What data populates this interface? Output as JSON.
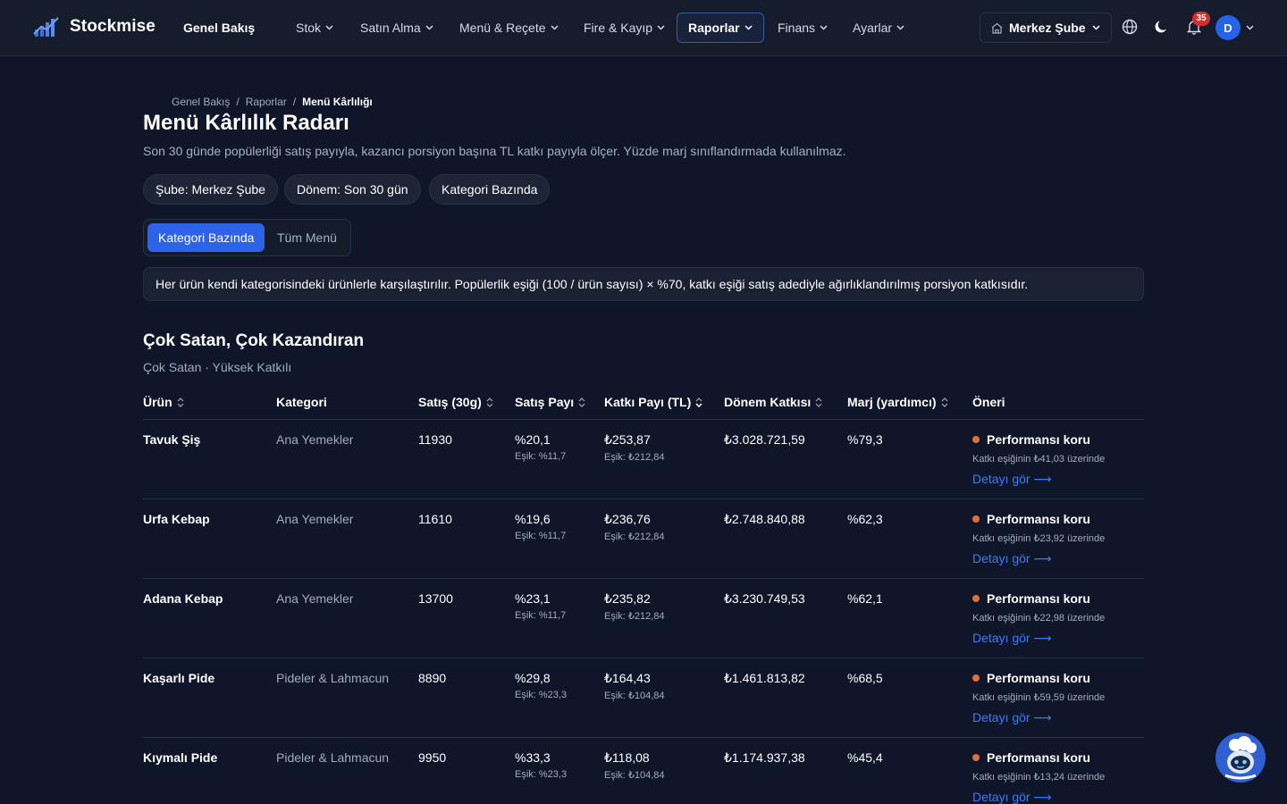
{
  "brand": {
    "name": "Stockmise"
  },
  "nav": {
    "items": [
      {
        "label": "Genel Bakış"
      },
      {
        "label": "Stok"
      },
      {
        "label": "Satın Alma"
      },
      {
        "label": "Menü & Reçete"
      },
      {
        "label": "Fire & Kayıp"
      },
      {
        "label": "Raporlar"
      },
      {
        "label": "Finans"
      },
      {
        "label": "Ayarlar"
      }
    ],
    "active": "Raporlar",
    "branch": "Merkez Şube",
    "notification_count": "35",
    "avatar_initial": "D"
  },
  "breadcrumb": {
    "home": "Genel Bakış",
    "section": "Raporlar",
    "current": "Menü Kârlılığı",
    "separator": "/"
  },
  "page": {
    "title": "Menü Kârlılık Radarı",
    "description": "Son 30 günde popülerliği satış payıyla, kazancı porsiyon başına TL katkı payıyla ölçer. Yüzde marj sınıflandırmada kullanılmaz."
  },
  "filters": {
    "branch": "Şube: Merkez Şube",
    "period": "Dönem: Son 30 gün",
    "mode": "Kategori Bazında"
  },
  "toggle": {
    "option_a": "Kategori Bazında",
    "option_b": "Tüm Menü",
    "selected": "Kategori Bazında"
  },
  "info": "Her ürün kendi kategorisindeki ürünlerle karşılaştırılır. Popülerlik eşiği (100 / ürün sayısı) × %70, katkı eşiği satış adediyle ağırlıklandırılmış porsiyon katkısıdır.",
  "section": {
    "title": "Çok Satan, Çok Kazandıran",
    "subtitle": "Çok Satan · Yüksek Katkılı"
  },
  "table": {
    "headers": {
      "product": "Ürün",
      "category": "Kategori",
      "sales": "Satış (30g)",
      "sales_share": "Satış Payı",
      "contribution": "Katkı Payı (TL)",
      "period_contribution": "Dönem Katkısı",
      "margin": "Marj (yardımcı)",
      "recommendation": "Öneri"
    },
    "rows": [
      {
        "product": "Tavuk Şiş",
        "category": "Ana Yemekler",
        "sales": "11930",
        "share": "%20,1",
        "share_threshold": "Eşik: %11,7",
        "contribution": "₺253,87",
        "contribution_threshold": "Eşik: ₺212,84",
        "period": "₺3.028.721,59",
        "margin": "%79,3",
        "rec": "Performansı koru",
        "note": "Katkı eşiğinin ₺41,03 üzerinde",
        "link": "Detayı gör ⟶"
      },
      {
        "product": "Urfa Kebap",
        "category": "Ana Yemekler",
        "sales": "11610",
        "share": "%19,6",
        "share_threshold": "Eşik: %11,7",
        "contribution": "₺236,76",
        "contribution_threshold": "Eşik: ₺212,84",
        "period": "₺2.748.840,88",
        "margin": "%62,3",
        "rec": "Performansı koru",
        "note": "Katkı eşiğinin ₺23,92 üzerinde",
        "link": "Detayı gör ⟶"
      },
      {
        "product": "Adana Kebap",
        "category": "Ana Yemekler",
        "sales": "13700",
        "share": "%23,1",
        "share_threshold": "Eşik: %11,7",
        "contribution": "₺235,82",
        "contribution_threshold": "Eşik: ₺212,84",
        "period": "₺3.230.749,53",
        "margin": "%62,1",
        "rec": "Performansı koru",
        "note": "Katkı eşiğinin ₺22,98 üzerinde",
        "link": "Detayı gör ⟶"
      },
      {
        "product": "Kaşarlı Pide",
        "category": "Pideler & Lahmacun",
        "sales": "8890",
        "share": "%29,8",
        "share_threshold": "Eşik: %23,3",
        "contribution": "₺164,43",
        "contribution_threshold": "Eşik: ₺104,84",
        "period": "₺1.461.813,82",
        "margin": "%68,5",
        "rec": "Performansı koru",
        "note": "Katkı eşiğinin ₺59,59 üzerinde",
        "link": "Detayı gör ⟶"
      },
      {
        "product": "Kıymalı Pide",
        "category": "Pideler & Lahmacun",
        "sales": "9950",
        "share": "%33,3",
        "share_threshold": "Eşik: %23,3",
        "contribution": "₺118,08",
        "contribution_threshold": "Eşik: ₺104,84",
        "period": "₺1.174.937,38",
        "margin": "%45,4",
        "rec": "Performansı koru",
        "note": "Katkı eşiğinin ₺13,24 üzerinde",
        "link": "Detayı gör ⟶"
      }
    ]
  },
  "colors": {
    "background": "#0f1629",
    "accent": "#2d63e8",
    "link": "#3b7bf6",
    "status_dot": "#e0703a",
    "badge": "#d32f2f"
  },
  "icons": {
    "globe": "globe-icon",
    "theme": "moon-icon",
    "notifications": "bell-icon",
    "branch": "store-icon",
    "assistant": "chef-bot-icon"
  }
}
